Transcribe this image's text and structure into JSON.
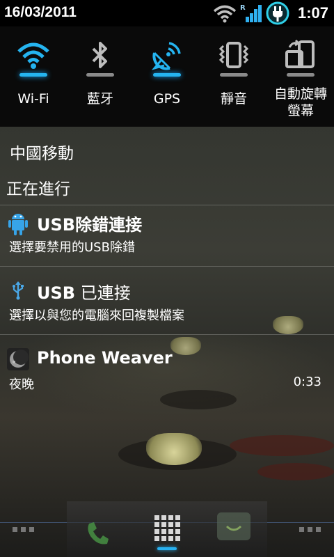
{
  "status_bar": {
    "date": "16/03/2011",
    "time": "1:07",
    "icons": [
      "wifi-signal-icon",
      "roaming-r-icon",
      "cell-signal-icon",
      "usb-charging-icon"
    ]
  },
  "quick_toggles": [
    {
      "label": "Wi-Fi",
      "icon": "wifi-icon",
      "state": "on"
    },
    {
      "label": "藍牙",
      "icon": "bluetooth-icon",
      "state": "off"
    },
    {
      "label": "GPS",
      "icon": "gps-satellite-icon",
      "state": "on"
    },
    {
      "label": "靜音",
      "icon": "vibrate-icon",
      "state": "off"
    },
    {
      "label_line1": "自動旋轉",
      "label_line2": "螢幕",
      "icon": "auto-rotate-icon",
      "state": "off"
    }
  ],
  "carrier": "中國移動",
  "ongoing_header": "正在進行",
  "notifications": [
    {
      "title": "USB除錯連接",
      "subtitle": "選擇要禁用的USB除錯",
      "icon": "android-icon"
    },
    {
      "title_bold": "USB",
      "title_rest": " 已連接",
      "subtitle": "選擇以與您的電腦來回複製檔案",
      "icon": "usb-icon"
    },
    {
      "title": "Phone Weaver",
      "subtitle": "夜晚",
      "time": "0:33",
      "icon": "moon-icon"
    }
  ],
  "colors": {
    "accent": "#25b4f0",
    "status_bar_bg": "#000000",
    "toggle_bg": "#0a0a0a",
    "usb_icon": "#4aa8e8"
  }
}
